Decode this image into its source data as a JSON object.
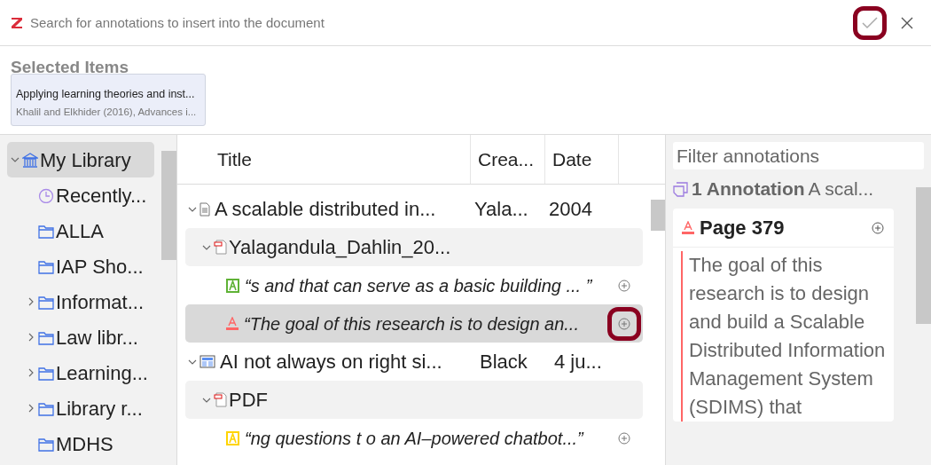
{
  "search": {
    "placeholder": "Search for annotations to insert into the document"
  },
  "selected_items": {
    "heading": "Selected Items",
    "items": [
      {
        "title": "Applying learning theories and inst...",
        "subtitle": "Khalil and Elkhider (2016), Advances i..."
      }
    ]
  },
  "collections": [
    {
      "label": "My Library",
      "kind": "library",
      "expanded": true,
      "selected": true,
      "children": [
        {
          "label": "Recently...",
          "kind": "recent",
          "selected": false
        },
        {
          "label": "ALLA",
          "kind": "folder",
          "selected": false
        },
        {
          "label": "IAP Sho...",
          "kind": "folder",
          "selected": false
        },
        {
          "label": "Informat...",
          "kind": "folder",
          "expanded": false,
          "selected": false
        },
        {
          "label": "Law libr...",
          "kind": "folder",
          "expanded": false,
          "selected": false
        },
        {
          "label": "Learning...",
          "kind": "folder",
          "expanded": false,
          "selected": false
        },
        {
          "label": "Library r...",
          "kind": "folder",
          "expanded": false,
          "selected": false
        },
        {
          "label": "MDHS",
          "kind": "folder",
          "selected": false
        }
      ]
    }
  ],
  "table": {
    "columns": [
      "Title",
      "Crea...",
      "Date"
    ],
    "rows": [
      {
        "kind": "document",
        "title": "A scalable distributed in...",
        "creator": "Yala...",
        "date": "2004",
        "expanded": true,
        "children": [
          {
            "kind": "attachment",
            "title": "Yalagandula_Dahlin_20...",
            "expanded": true,
            "children": [
              {
                "kind": "highlight",
                "color": "#5fb236",
                "text": "“s and that can serve as a basic building ... ”",
                "selected": false
              },
              {
                "kind": "underline",
                "color": "#ff6666",
                "text": "“The goal of this research is to design an...",
                "selected": true
              }
            ]
          }
        ]
      },
      {
        "kind": "newspaper",
        "title": "AI not always on right si...",
        "creator": "Black",
        "date": "4 ju...",
        "expanded": true,
        "children": [
          {
            "kind": "attachment",
            "title": "PDF",
            "expanded": true,
            "children": [
              {
                "kind": "highlight",
                "color": "#ffd400",
                "text": "“ng questions t o an AI–powered chatbot...”",
                "selected": false
              }
            ]
          }
        ]
      }
    ]
  },
  "annotations_pane": {
    "filter_placeholder": "Filter annotations",
    "count": "1 Annotation",
    "parent_title": "A scal...",
    "cards": [
      {
        "kind": "underline",
        "color": "#ff6666",
        "page": "Page 379",
        "text": "The goal of this research is to design and build a Scalable Distributed Information Management System (SDIMS) that"
      }
    ]
  }
}
